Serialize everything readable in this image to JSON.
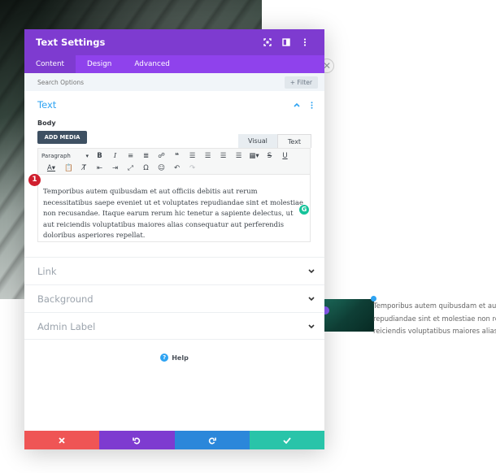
{
  "background": {
    "paragraph_lines": [
      "Temporibus autem quibusdam et aut offi",
      "repudiandae sint et molestiae non recusa",
      "reiciendis voluptatibus maiores alias cons"
    ]
  },
  "modal": {
    "title": "Text Settings",
    "tabs": [
      "Content",
      "Design",
      "Advanced"
    ],
    "search_placeholder": "Search Options",
    "filter_label": "+ Filter",
    "text_section": {
      "title": "Text",
      "body_label": "Body",
      "add_media_label": "ADD MEDIA",
      "editor_tabs": [
        "Visual",
        "Text"
      ],
      "format_select": "Paragraph",
      "content": "Temporibus autem quibusdam et aut officiis debitis aut rerum necessitatibus saepe eveniet ut et voluptates repudiandae sint et molestiae non recusandae. Itaque earum rerum hic tenetur a sapiente delectus, ut aut reiciendis voluptatibus maiores alias consequatur aut perferendis doloribus asperiores repellat."
    },
    "sections": [
      "Link",
      "Background",
      "Admin Label"
    ],
    "help_label": "Help",
    "step_number": "1"
  },
  "colors": {
    "header": "#7e3bd0",
    "tabs_bar": "#8f42ec",
    "accent": "#2ea3f2",
    "cancel": "#ef5555",
    "undo": "#7e3bd0",
    "redo": "#2b87da",
    "save": "#29c4a9"
  }
}
